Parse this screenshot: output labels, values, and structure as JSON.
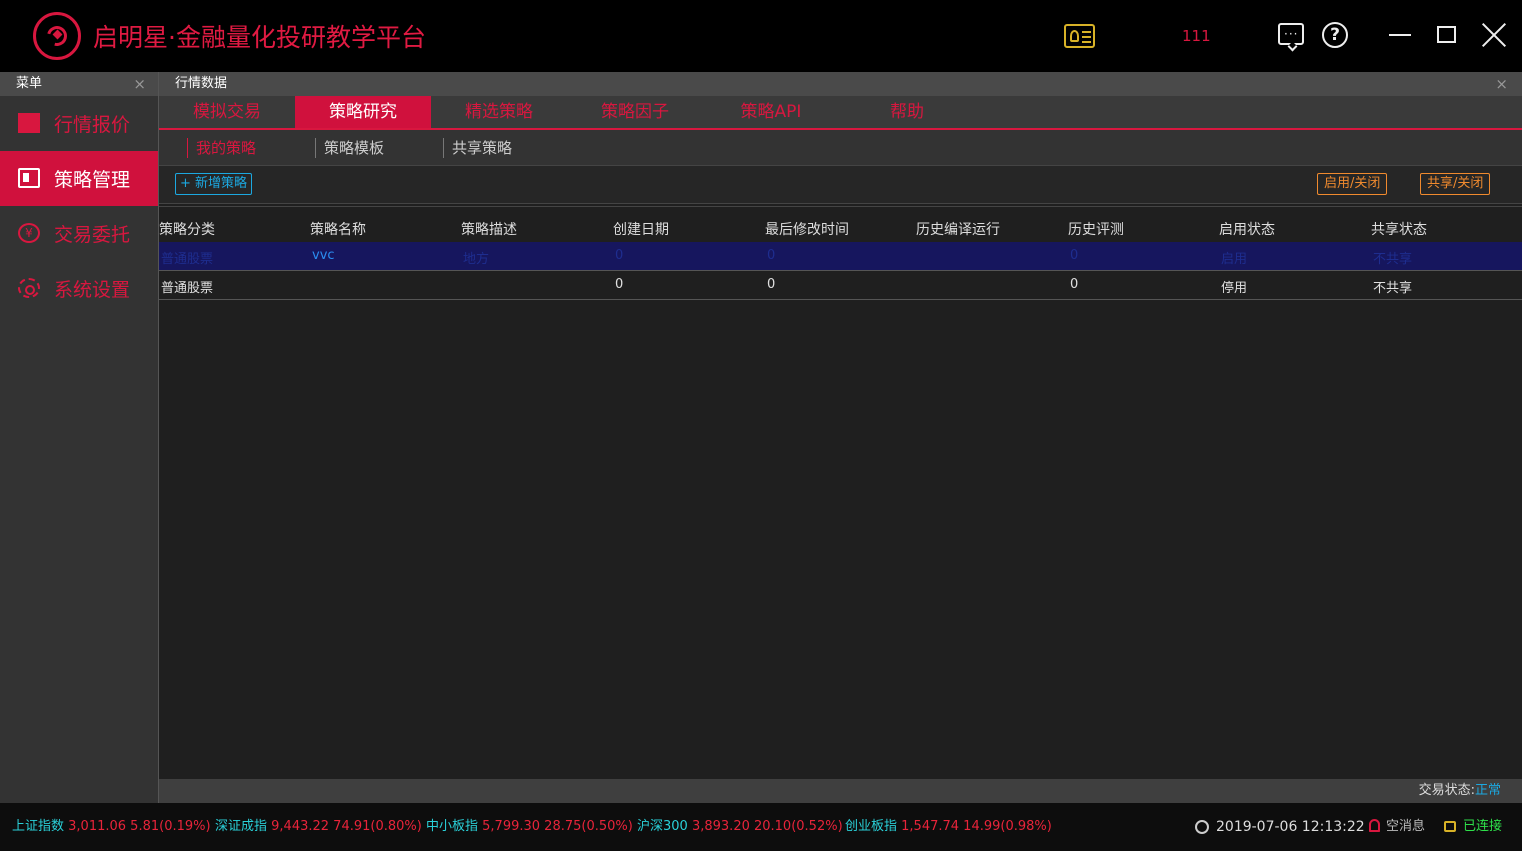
{
  "app": {
    "title": "启明星·金融量化投研教学平台",
    "user_number": "111"
  },
  "sidebar": {
    "header": "菜单",
    "close": "×",
    "items": [
      {
        "label": "行情报价",
        "icon": "chart-icon",
        "active": false
      },
      {
        "label": "策略管理",
        "icon": "card-icon",
        "active": true
      },
      {
        "label": "交易委托",
        "icon": "yen-icon",
        "active": false
      },
      {
        "label": "系统设置",
        "icon": "gear-icon",
        "active": false
      }
    ]
  },
  "main": {
    "header": "行情数据",
    "close": "×",
    "tabs": [
      {
        "label": "模拟交易"
      },
      {
        "label": "策略研究"
      },
      {
        "label": "精选策略"
      },
      {
        "label": "策略因子"
      },
      {
        "label": "策略API"
      },
      {
        "label": "帮助"
      }
    ],
    "subtabs": [
      {
        "label": "我的策略"
      },
      {
        "label": "策略模板"
      },
      {
        "label": "共享策略"
      }
    ],
    "toolbar": {
      "new_label": "+ 新增策略",
      "enable_label": "启用/关闭",
      "share_label": "共享/关闭"
    },
    "table": {
      "columns": [
        "策略分类",
        "策略名称",
        "策略描述",
        "创建日期",
        "最后修改时间",
        "历史编译运行",
        "历史评测",
        "启用状态",
        "共享状态"
      ],
      "rows": [
        [
          "普通股票",
          "vvc",
          "地方",
          "0",
          "0",
          "",
          "0",
          "启用",
          "不共享"
        ],
        [
          "普通股票",
          "",
          "",
          "0",
          "0",
          "",
          "0",
          "停用",
          "不共享"
        ]
      ]
    },
    "status": {
      "label": "交易状态:",
      "value": "正常"
    }
  },
  "bottom": {
    "indices": [
      {
        "name": "上证指数",
        "value": "3,011.06 5.81(0.19%)"
      },
      {
        "name": "深证成指",
        "value": "9,443.22 74.91(0.80%)"
      },
      {
        "name": "中小板指",
        "value": "5,799.30 28.75(0.50%)"
      },
      {
        "name": "沪深300",
        "value": "3,893.20 20.10(0.52%)"
      },
      {
        "name": "创业板指",
        "value": "1,547.74 14.99(0.98%)"
      }
    ],
    "datetime": "2019-07-06 12:13:22",
    "messages": "空消息",
    "connection": "已连接"
  },
  "colors": {
    "accent": "#d0113d",
    "brand_red": "#e01a42",
    "info_blue": "#1ca8e0",
    "warn_orange": "#f08a2e",
    "ok_green": "#2ee04a",
    "index_cyan": "#2ad0d8",
    "selected_row": "#16165e"
  }
}
